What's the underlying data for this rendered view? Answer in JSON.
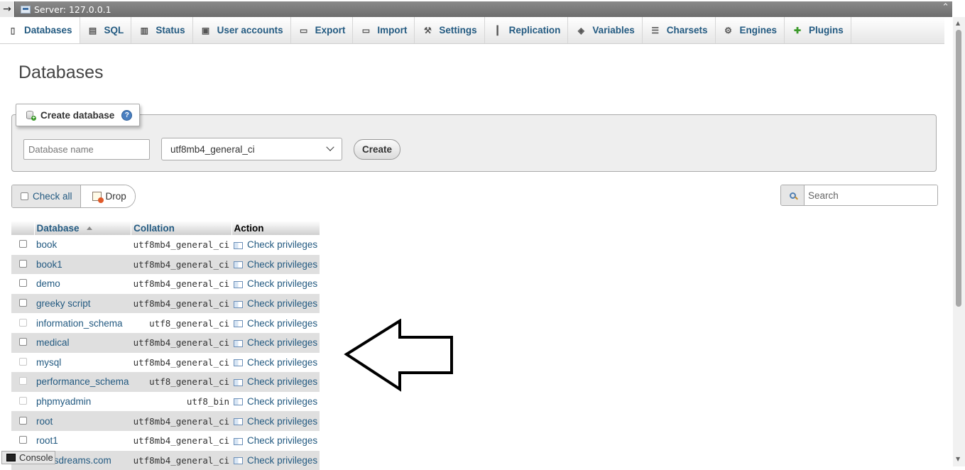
{
  "server_bar": {
    "toggle_glyph": "→",
    "label": "Server: 127.0.0.1",
    "collapse_glyph": "⌃"
  },
  "tabs": [
    {
      "label": "Databases",
      "icon": "database-icon",
      "active": true
    },
    {
      "label": "SQL",
      "icon": "sql-icon"
    },
    {
      "label": "Status",
      "icon": "status-icon"
    },
    {
      "label": "User accounts",
      "icon": "user-accounts-icon"
    },
    {
      "label": "Export",
      "icon": "export-icon"
    },
    {
      "label": "Import",
      "icon": "import-icon"
    },
    {
      "label": "Settings",
      "icon": "wrench-icon"
    },
    {
      "label": "Replication",
      "icon": "replication-icon"
    },
    {
      "label": "Variables",
      "icon": "variables-icon"
    },
    {
      "label": "Charsets",
      "icon": "charsets-icon"
    },
    {
      "label": "Engines",
      "icon": "engines-icon"
    },
    {
      "label": "Plugins",
      "icon": "puzzle-icon"
    }
  ],
  "page_title": "Databases",
  "create_db": {
    "legend": "Create database",
    "name_placeholder": "Database name",
    "collation_selected": "utf8mb4_general_ci",
    "create_label": "Create"
  },
  "bulk": {
    "check_all_label": "Check all",
    "drop_label": "Drop"
  },
  "search": {
    "placeholder": "Search"
  },
  "table": {
    "headers": {
      "database": "Database",
      "collation": "Collation",
      "action": "Action"
    },
    "action_label": "Check privileges",
    "rows": [
      {
        "name": "book",
        "collation": "utf8mb4_general_ci",
        "disabled": false
      },
      {
        "name": "book1",
        "collation": "utf8mb4_general_ci",
        "disabled": false
      },
      {
        "name": "demo",
        "collation": "utf8mb4_general_ci",
        "disabled": false
      },
      {
        "name": "greeky script",
        "collation": "utf8mb4_general_ci",
        "disabled": false
      },
      {
        "name": "information_schema",
        "collation": "utf8_general_ci",
        "disabled": true
      },
      {
        "name": "medical",
        "collation": "utf8mb4_general_ci",
        "disabled": false
      },
      {
        "name": "mysql",
        "collation": "utf8mb4_general_ci",
        "disabled": true
      },
      {
        "name": "performance_schema",
        "collation": "utf8_general_ci",
        "disabled": true
      },
      {
        "name": "phpmyadmin",
        "collation": "utf8_bin",
        "disabled": true
      },
      {
        "name": "root",
        "collation": "utf8mb4_general_ci",
        "disabled": false
      },
      {
        "name": "root1",
        "collation": "utf8mb4_general_ci",
        "disabled": false
      },
      {
        "name": "ciousdreams.com",
        "collation": "utf8mb4_general_ci",
        "disabled": false
      }
    ]
  },
  "console": {
    "label": "Console"
  },
  "colors": {
    "link": "#235a81",
    "row_alt": "#dfdfdf",
    "header_bar": "#6d6d6d"
  }
}
